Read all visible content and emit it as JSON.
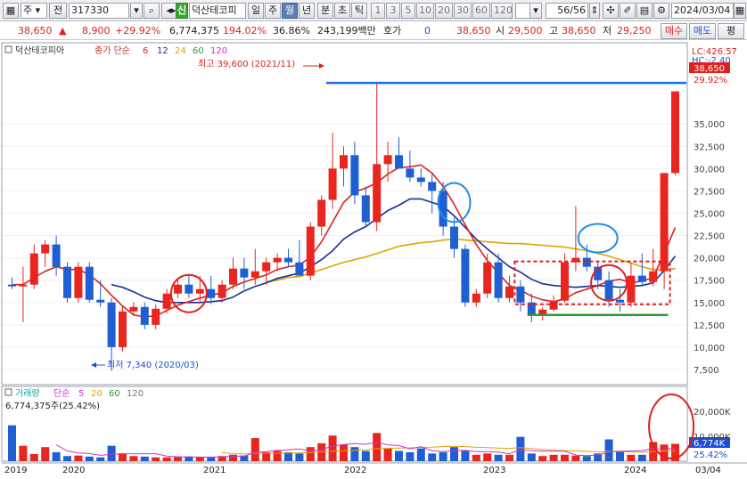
{
  "toolbar": {
    "period_selector": "주",
    "prev_label": "전",
    "code": "317330",
    "badge": "신",
    "stock_name": "덕산테코피",
    "period_tabs": [
      "일",
      "주",
      "월",
      "년",
      "분",
      "초",
      "틱"
    ],
    "active_period": "월",
    "intervals": [
      "1",
      "3",
      "5",
      "10",
      "20",
      "30",
      "60",
      "120"
    ],
    "count": "56/56",
    "date": "2024/03/04"
  },
  "quote": {
    "price": "38,650",
    "change": "8,900",
    "change_pct": "+29.92%",
    "volume": "6,774,375",
    "vol_ratio": "194.02%",
    "turnover": "36.86%",
    "amount": "243,199백만",
    "hoga_label": "호가",
    "hoga_value": "0",
    "current": "38,650",
    "open_label": "시",
    "open": "29,500",
    "high_label": "고",
    "high": "38,650",
    "low_label": "저",
    "low": "29,250",
    "buy_label": "매수",
    "sell_label": "매도",
    "eval_label": "평"
  },
  "chart_data": {
    "type": "candlestick",
    "title": "덕산테코피아",
    "legend": [
      "종가 단순",
      "6",
      "12",
      "24",
      "60",
      "120"
    ],
    "legend_colors": [
      "#c0392b",
      "#e0201b",
      "#1a2e9a",
      "#e0a400",
      "#2aa02a",
      "#cc33cc"
    ],
    "ylim": [
      6000,
      42500
    ],
    "y_ticks": [
      "7,500",
      "10,000",
      "12,500",
      "15,000",
      "17,500",
      "20,000",
      "22,500",
      "25,000",
      "27,500",
      "30,000",
      "32,500",
      "35,000"
    ],
    "right_labels": {
      "lc": "LC:426.57",
      "hc": "HC:-2.40",
      "last": "38,650",
      "pct": "29.92%"
    },
    "annotations": {
      "high": "최고 39,600 (2021/11)",
      "low": "최저 7,340 (2020/03)"
    },
    "x_labels": [
      "2019",
      "2020",
      "2021",
      "2022",
      "2023",
      "2024",
      "03/04"
    ],
    "candles": [
      [
        17000,
        17800,
        16500,
        16800
      ],
      [
        16800,
        19000,
        12800,
        17000
      ],
      [
        17000,
        21500,
        16500,
        20500
      ],
      [
        20500,
        22000,
        19000,
        21500
      ],
      [
        21500,
        22500,
        18000,
        19000
      ],
      [
        19000,
        19500,
        15000,
        15500
      ],
      [
        15500,
        19500,
        15000,
        19000
      ],
      [
        19000,
        19500,
        15000,
        15300
      ],
      [
        15300,
        17500,
        14500,
        15000
      ],
      [
        15000,
        15500,
        7340,
        10000
      ],
      [
        10000,
        14500,
        9500,
        14000
      ],
      [
        14000,
        15000,
        13500,
        14500
      ],
      [
        14500,
        15000,
        12000,
        12500
      ],
      [
        12500,
        14800,
        12000,
        14300
      ],
      [
        14300,
        16500,
        13800,
        16000
      ],
      [
        16000,
        17500,
        15500,
        17000
      ],
      [
        17000,
        18000,
        15500,
        16000
      ],
      [
        16000,
        18000,
        15000,
        16500
      ],
      [
        16500,
        18000,
        14800,
        15500
      ],
      [
        15500,
        17500,
        15000,
        17000
      ],
      [
        17000,
        20000,
        16500,
        18800
      ],
      [
        18800,
        20000,
        16500,
        17800
      ],
      [
        17800,
        21000,
        17000,
        18500
      ],
      [
        18500,
        20000,
        17000,
        19500
      ],
      [
        19500,
        20500,
        18500,
        20000
      ],
      [
        20000,
        21000,
        19000,
        19500
      ],
      [
        19500,
        22000,
        18500,
        18000
      ],
      [
        18000,
        24000,
        17500,
        23500
      ],
      [
        23500,
        27000,
        22500,
        26500
      ],
      [
        26500,
        34000,
        25500,
        30000
      ],
      [
        30000,
        32500,
        28000,
        31500
      ],
      [
        31500,
        33000,
        26000,
        27000
      ],
      [
        27000,
        28000,
        23500,
        24000
      ],
      [
        24000,
        39600,
        23000,
        30500
      ],
      [
        30500,
        33000,
        28500,
        31500
      ],
      [
        31500,
        33500,
        30000,
        30000
      ],
      [
        30000,
        32000,
        28500,
        29000
      ],
      [
        29000,
        30000,
        28000,
        28500
      ],
      [
        28500,
        29500,
        25000,
        27500
      ],
      [
        27500,
        28500,
        22500,
        23500
      ],
      [
        23500,
        24500,
        20000,
        21000
      ],
      [
        21000,
        21500,
        14500,
        15000
      ],
      [
        15000,
        16500,
        14500,
        16000
      ],
      [
        16000,
        20500,
        15500,
        19500
      ],
      [
        19500,
        20500,
        15000,
        15500
      ],
      [
        15500,
        18000,
        15000,
        16800
      ],
      [
        16800,
        17500,
        14000,
        15000
      ],
      [
        15000,
        16000,
        12800,
        13500
      ],
      [
        13500,
        14500,
        13000,
        14200
      ],
      [
        14200,
        15800,
        14000,
        15200
      ],
      [
        15200,
        20500,
        15000,
        19500
      ],
      [
        19500,
        25800,
        18500,
        20000
      ],
      [
        20000,
        21500,
        18500,
        19000
      ],
      [
        19000,
        19500,
        16500,
        17500
      ],
      [
        17500,
        18500,
        14500,
        15300
      ],
      [
        15300,
        16500,
        14000,
        15000
      ],
      [
        15000,
        19500,
        14500,
        18000
      ],
      [
        18000,
        20500,
        17000,
        17300
      ],
      [
        17300,
        21000,
        16800,
        18500
      ],
      [
        18500,
        24000,
        16500,
        29500
      ],
      [
        29500,
        36500,
        29250,
        38650
      ]
    ],
    "ma6": [
      17000,
      17000,
      17800,
      18500,
      19000,
      18700,
      18700,
      18100,
      17100,
      15800,
      14600,
      13600,
      13400,
      13500,
      14100,
      14700,
      15100,
      15500,
      15800,
      16100,
      16800,
      17300,
      17700,
      18100,
      18700,
      19000,
      19200,
      20100,
      21800,
      24000,
      26200,
      27400,
      27800,
      28400,
      29400,
      30100,
      30200,
      30400,
      29500,
      28000,
      26000,
      23700,
      21500,
      19700,
      18300,
      16900,
      16400,
      15700,
      15300,
      15100,
      15400,
      16100,
      16500,
      16900,
      17400,
      17600,
      17200,
      17400,
      17800,
      20500,
      23400
    ],
    "ma12": [
      null,
      null,
      null,
      null,
      null,
      null,
      null,
      null,
      null,
      17000,
      16700,
      16200,
      15600,
      15200,
      15000,
      15000,
      15000,
      15000,
      15100,
      15200,
      15600,
      16300,
      16800,
      17200,
      17700,
      18000,
      18300,
      19000,
      19800,
      20800,
      22100,
      22900,
      23500,
      24400,
      25300,
      25900,
      26600,
      26600,
      26200,
      25800,
      24700,
      23400,
      22100,
      21000,
      20000,
      19000,
      18400,
      17600,
      17100,
      16900,
      16800,
      16700,
      16800,
      16900,
      16800,
      16700,
      16800,
      16900,
      17200,
      18600,
      20200
    ],
    "ma24": [
      null,
      null,
      null,
      null,
      null,
      null,
      null,
      null,
      null,
      null,
      null,
      null,
      null,
      null,
      null,
      null,
      null,
      null,
      null,
      null,
      null,
      null,
      null,
      17300,
      17500,
      17800,
      17900,
      18300,
      18700,
      19100,
      19500,
      19800,
      20100,
      20500,
      20900,
      21300,
      21500,
      21700,
      21800,
      22000,
      22100,
      22000,
      21900,
      21800,
      21700,
      21600,
      21600,
      21500,
      21400,
      21300,
      21200,
      21000,
      20800,
      20500,
      20200,
      19800,
      19400,
      19000,
      18700,
      18600,
      18800
    ],
    "volume_legend": [
      "거래량",
      "단순",
      "5",
      "20",
      "60",
      "120"
    ],
    "volume_label": "6,774,375주(25.42%)",
    "volume_ticks": [
      "20,000K",
      "10,000K"
    ],
    "volume_right": {
      "last": "6,774K",
      "pct": "25.42%"
    },
    "volume": [
      14000,
      6000,
      2800,
      5500,
      3500,
      2000,
      2200,
      1800,
      1500,
      6000,
      3000,
      2000,
      1800,
      1500,
      1500,
      1700,
      1800,
      1600,
      1500,
      2000,
      2500,
      2200,
      9000,
      3500,
      4000,
      3500,
      3000,
      5500,
      7000,
      10000,
      6500,
      5500,
      4000,
      11000,
      5000,
      4000,
      3500,
      5000,
      3000,
      3500,
      5500,
      4000,
      2500,
      3000,
      2500,
      2500,
      9500,
      3000,
      2000,
      2500,
      2500,
      2200,
      2000,
      3000,
      8500,
      4000,
      2500,
      2500,
      7500,
      6500,
      6774
    ],
    "volume_ma5": [
      null,
      null,
      null,
      null,
      6400,
      4000,
      3200,
      3000,
      2300,
      2700,
      2900,
      2900,
      2900,
      2900,
      2000,
      1700,
      1700,
      1600,
      1600,
      1700,
      1900,
      2000,
      3400,
      3700,
      4200,
      4400,
      4800,
      4000,
      4500,
      5900,
      6500,
      6900,
      6600,
      7400,
      6400,
      6100,
      4800,
      5700,
      4100,
      3800,
      4100,
      4200,
      3700,
      3700,
      3500,
      2900,
      4400,
      4100,
      3900,
      3900,
      3900,
      2400,
      2200,
      2400,
      3600,
      3900,
      4000,
      4100,
      5000,
      4600,
      5200
    ],
    "volume_ma20": [
      null,
      null,
      null,
      null,
      null,
      null,
      null,
      null,
      null,
      null,
      null,
      null,
      null,
      null,
      null,
      null,
      null,
      null,
      null,
      3300,
      2900,
      2800,
      3100,
      3100,
      3100,
      3200,
      3200,
      3400,
      3700,
      3900,
      4100,
      4300,
      4400,
      4900,
      5000,
      5100,
      5200,
      5400,
      5500,
      5700,
      5800,
      5700,
      5400,
      5300,
      5100,
      5000,
      5300,
      4900,
      4600,
      4300,
      4100,
      4000,
      3900,
      3600,
      3800,
      3800,
      3600,
      3500,
      3800,
      4000,
      4100
    ],
    "volume_ma60": [
      null,
      null,
      null,
      null,
      null,
      null,
      null,
      null,
      null,
      null,
      null,
      null,
      null,
      null,
      null,
      null,
      null,
      null,
      null,
      null,
      null,
      null,
      null,
      null,
      null,
      null,
      null,
      null,
      null,
      null,
      null,
      null,
      null,
      null,
      null,
      null,
      null,
      null,
      null,
      null,
      null,
      null,
      null,
      null,
      null,
      null,
      null,
      null,
      null,
      null,
      null,
      null,
      null,
      null,
      null,
      null,
      null,
      null,
      null,
      4100,
      4200
    ],
    "pattern_box": {
      "from": 46,
      "to": 59,
      "low": 14800,
      "high": 19600
    },
    "support_line": {
      "from": 47,
      "to": 59,
      "value": 13600
    },
    "resistance_line": {
      "from": 0,
      "to": 61,
      "value": 39600
    },
    "circles": [
      {
        "candle": 16,
        "value": 16000
      },
      {
        "candle": 40,
        "value": 26200
      },
      {
        "candle": 53,
        "value": 22200
      },
      {
        "candle": 54,
        "value": 17200
      }
    ],
    "volume_circle": {
      "candle": 59
    }
  }
}
